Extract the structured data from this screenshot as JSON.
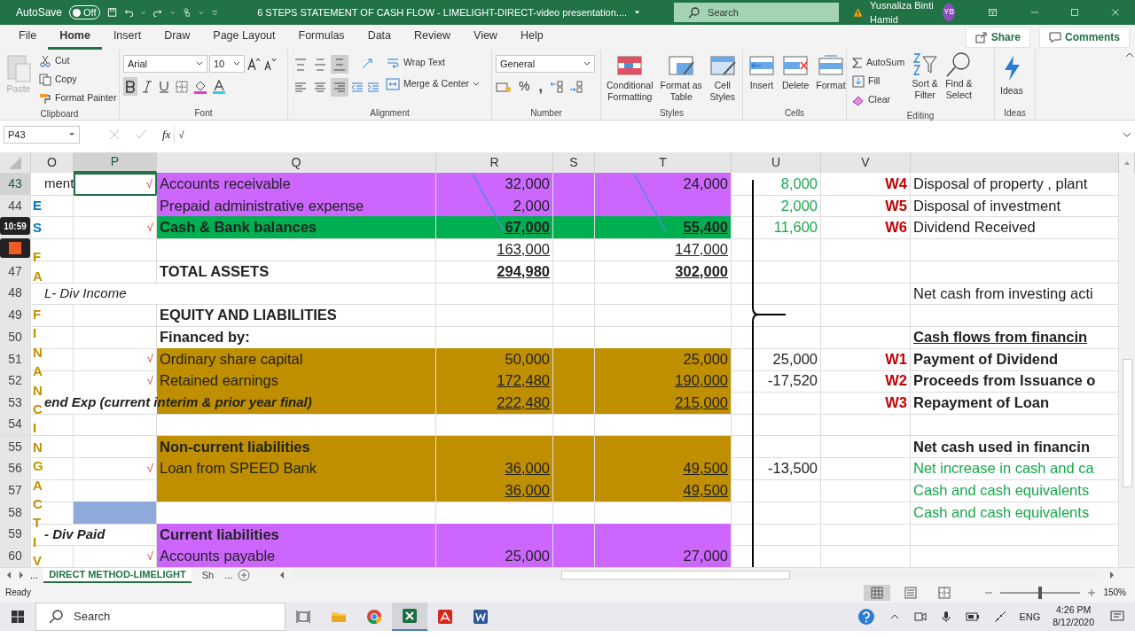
{
  "title_bar": {
    "autosave_label": "AutoSave",
    "autosave": {
      "on": false,
      "label": "Off"
    },
    "document_title": "6 STEPS STATEMENT OF CASH FLOW - LIMELIGHT-DIRECT-video presentation....",
    "search_placeholder": "Search",
    "user_name": "Yusnaliza Binti Hamid",
    "avatar_initials": "YB"
  },
  "ribbon_tabs": [
    {
      "label": "File",
      "selected": false
    },
    {
      "label": "Home",
      "selected": true
    },
    {
      "label": "Insert",
      "selected": false
    },
    {
      "label": "Draw",
      "selected": false
    },
    {
      "label": "Page Layout",
      "selected": false
    },
    {
      "label": "Formulas",
      "selected": false
    },
    {
      "label": "Data",
      "selected": false
    },
    {
      "label": "Review",
      "selected": false
    },
    {
      "label": "View",
      "selected": false
    },
    {
      "label": "Help",
      "selected": false
    }
  ],
  "share_label": "Share",
  "comments_label": "Comments",
  "clipboard": {
    "paste": "Paste",
    "cut": "Cut",
    "copy": "Copy",
    "format_painter": "Format Painter",
    "label": "Clipboard"
  },
  "font": {
    "name": "Arial",
    "size": "10",
    "bold": true,
    "italic": false,
    "underline": false,
    "label": "Font"
  },
  "alignment": {
    "vertical": [
      {
        "kind": "top",
        "selected": false
      },
      {
        "kind": "middle",
        "selected": false
      },
      {
        "kind": "bottom",
        "selected": true
      }
    ],
    "horizontal": [
      {
        "kind": "left",
        "selected": false
      },
      {
        "kind": "center",
        "selected": false
      },
      {
        "kind": "right",
        "selected": true
      }
    ],
    "wrap_text": "Wrap Text",
    "merge": "Merge & Center",
    "label": "Alignment"
  },
  "number": {
    "format": "General",
    "percent": "%",
    "comma": ",",
    "label": "Number"
  },
  "styles": {
    "items": [
      {
        "kind": "conditional",
        "lines": [
          "Conditional",
          "Formatting"
        ]
      },
      {
        "kind": "table",
        "lines": [
          "Format as",
          "Table"
        ]
      },
      {
        "kind": "cell",
        "lines": [
          "Cell",
          "Styles"
        ]
      }
    ],
    "label": "Styles"
  },
  "cells": {
    "items": [
      {
        "kind": "insert",
        "label": "Insert"
      },
      {
        "kind": "delete",
        "label": "Delete"
      },
      {
        "kind": "format",
        "label": "Format"
      }
    ],
    "label": "Cells"
  },
  "editing": {
    "autosum": "AutoSum",
    "fill": "Fill",
    "clear": "Clear",
    "sort": [
      "Sort &",
      "Filter"
    ],
    "find": [
      "Find &",
      "Select"
    ],
    "label": "Editing"
  },
  "ideas": {
    "button": "Ideas",
    "label": "Ideas"
  },
  "formula_bar": {
    "name_box": "P43",
    "fx": "fx",
    "formula": "√"
  },
  "columns": [
    {
      "label": "O",
      "selected": false
    },
    {
      "label": "P",
      "selected": true
    },
    {
      "label": "Q",
      "selected": false
    },
    {
      "label": "R",
      "selected": false
    },
    {
      "label": "S",
      "selected": false
    },
    {
      "label": "T",
      "selected": false
    },
    {
      "label": "U",
      "selected": false
    },
    {
      "label": "V",
      "selected": false
    }
  ],
  "vertical_labels": [
    {
      "text": "ES",
      "color": "#0070c0"
    },
    {
      "text": "FA",
      "color": "#c09000"
    },
    {
      "text": "FINANCINGACTIV",
      "color": "#c09000"
    }
  ],
  "recorder": {
    "time": "10:59"
  },
  "rows": [
    {
      "number": "43",
      "selected": true,
      "o": "ment",
      "o_italic": false,
      "o_bold": false,
      "p": "√",
      "q": "Accounts receivable",
      "q_bold": false,
      "color": "#cc66ff",
      "r": "32,000",
      "t": "24,000",
      "figures_bold": false,
      "figures_underline": false,
      "u": {
        "text": "8,000",
        "color": "#18a84a"
      },
      "v": "W4",
      "w": {
        "text": "Disposal  of property , plant",
        "bold": false,
        "underline": false
      }
    },
    {
      "number": "44",
      "selected": false,
      "q": "Prepaid administrative expense",
      "q_bold": false,
      "color": "#cc66ff",
      "r": "2,000",
      "figures_bold": false,
      "figures_underline": false,
      "u": {
        "text": "2,000",
        "color": "#18a84a"
      },
      "v": "W5",
      "w": {
        "text": "Disposal of investment",
        "bold": false,
        "underline": false
      }
    },
    {
      "selected": false,
      "p": "√",
      "q": "Cash & Bank balances",
      "q_bold": true,
      "color": "#00b050",
      "r": "67,000",
      "t": "55,400",
      "figures_bold": true,
      "figures_underline": true,
      "u": {
        "text": "11,600",
        "color": "#18a84a"
      },
      "v": "W6",
      "w": {
        "text": "Dividend Received",
        "bold": false,
        "underline": false
      }
    },
    {
      "selected": false,
      "r": "163,000",
      "t": "147,000",
      "figures_bold": false,
      "figures_underline": true
    },
    {
      "number": "47",
      "selected": false,
      "q": "TOTAL ASSETS",
      "q_bold": true,
      "r": "294,980",
      "t": "302,000",
      "figures_bold": true,
      "figures_underline": true
    },
    {
      "number": "48",
      "selected": false,
      "o": "L- Div Income",
      "o_italic": true,
      "o_bold": false,
      "w": {
        "text": "Net cash from investing acti",
        "bold": false,
        "underline": false
      }
    },
    {
      "number": "49",
      "selected": false,
      "q": "EQUITY AND LIABILITIES",
      "q_bold": true
    },
    {
      "number": "50",
      "selected": false,
      "q": "Financed by:",
      "q_bold": true,
      "w": {
        "text": "Cash flows from financin",
        "bold": true,
        "underline": true
      }
    },
    {
      "number": "51",
      "selected": false,
      "p": "√",
      "q": "Ordinary share capital",
      "q_bold": false,
      "color": "#bf8f00",
      "r": "50,000",
      "t": "25,000",
      "figures_bold": false,
      "figures_underline": false,
      "u": {
        "text": "25,000"
      },
      "v": "W1",
      "w": {
        "text": "Payment of Dividend",
        "bold": true,
        "underline": false
      }
    },
    {
      "number": "52",
      "selected": false,
      "p": "√",
      "q": "Retained earnings",
      "q_bold": false,
      "color": "#bf8f00",
      "r": "172,480",
      "t": "190,000",
      "figures_bold": false,
      "figures_underline": true,
      "u": {
        "text": "-17,520"
      },
      "v": "W2",
      "w": {
        "text": "Proceeds from Issuance o",
        "bold": true,
        "underline": false
      }
    },
    {
      "number": "53",
      "selected": false,
      "o": "end Exp  (current interim & prior year final)",
      "o_italic": true,
      "o_bold": true,
      "color": "#bf8f00",
      "r": "222,480",
      "t": "215,000",
      "figures_bold": false,
      "figures_underline": true,
      "v": "W3",
      "w": {
        "text": "Repayment of Loan",
        "bold": true,
        "underline": false
      }
    },
    {
      "number": "54",
      "selected": false
    },
    {
      "number": "55",
      "selected": false,
      "q": "Non-current liabilities",
      "q_bold": true,
      "color": "#bf8f00",
      "w": {
        "text": "Net cash used in financin",
        "bold": true,
        "underline": false
      }
    },
    {
      "number": "56",
      "selected": false,
      "p": "√",
      "q": "Loan from SPEED Bank",
      "q_bold": false,
      "color": "#bf8f00",
      "r": "36,000",
      "t": "49,500",
      "figures_bold": false,
      "figures_underline": true,
      "u": {
        "text": "-13,500"
      },
      "w": {
        "text": "Net increase in cash and ca",
        "bold": false,
        "underline": false,
        "color": "#18a84a"
      }
    },
    {
      "number": "57",
      "selected": false,
      "color": "#bf8f00",
      "r": "36,000",
      "t": "49,500",
      "figures_bold": false,
      "figures_underline": true,
      "w": {
        "text": "Cash and cash equivalents",
        "bold": false,
        "underline": false,
        "color": "#18a84a"
      }
    },
    {
      "number": "58",
      "selected": false,
      "p_highlight": true,
      "w": {
        "text": "Cash and cash equivalents",
        "bold": false,
        "underline": false,
        "color": "#18a84a"
      }
    },
    {
      "number": "59",
      "selected": false,
      "o": "- Div Paid",
      "o_italic": true,
      "o_bold": true,
      "q": "Current liabilities",
      "q_bold": true,
      "color": "#cc66ff"
    },
    {
      "number": "60",
      "selected": false,
      "p": "√",
      "q": "Accounts payable",
      "q_bold": false,
      "color": "#cc66ff",
      "r": "25,000",
      "t": "27,000",
      "figures_bold": false,
      "figures_underline": false
    }
  ],
  "sheet_tabs": {
    "more": "...",
    "sheets": [
      {
        "label": "DIRECT METHOD-LIMELIGHT",
        "selected": true
      },
      {
        "label": "Sh",
        "selected": false
      }
    ],
    "overflow": "..."
  },
  "status_bar": {
    "status": "Ready",
    "view": [
      {
        "kind": "normal",
        "selected": true
      },
      {
        "kind": "layout",
        "selected": false
      },
      {
        "kind": "break",
        "selected": false
      }
    ],
    "zoom": {
      "level": 0.5,
      "label": "150%"
    }
  },
  "taskbar": {
    "search_placeholder": "Search",
    "apps": [
      {
        "kind": "explorer",
        "selected": false
      },
      {
        "kind": "chrome",
        "selected": false
      },
      {
        "kind": "excel",
        "selected": true
      },
      {
        "kind": "acrobat",
        "selected": false
      },
      {
        "kind": "word",
        "selected": false
      }
    ],
    "language": "ENG",
    "time": "4:26 PM",
    "date": "8/12/2020"
  }
}
